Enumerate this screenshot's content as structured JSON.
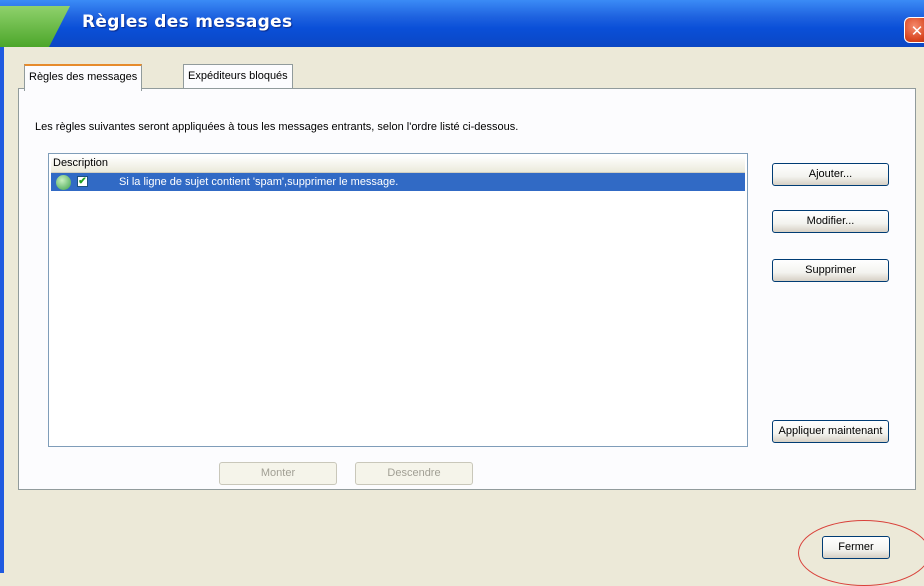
{
  "window": {
    "title": "Règles des messages",
    "close_glyph": "✕"
  },
  "tabs": [
    {
      "label": "Règles des messages",
      "active": true
    },
    {
      "label": "Expéditeurs bloqués",
      "active": false
    }
  ],
  "intro_text": "Les règles suivantes seront appliquées à tous les messages entrants, selon l'ordre listé ci-dessous.",
  "list": {
    "header": "Description",
    "rows": [
      {
        "checked": true,
        "check_glyph": "✔",
        "icon": "rule-icon",
        "text": "Si la ligne de sujet contient 'spam',supprimer le message.",
        "selected": true
      }
    ]
  },
  "buttons": {
    "add": "Ajouter...",
    "modify": "Modifier...",
    "delete": "Supprimer",
    "apply_now": "Appliquer maintenant",
    "move_up": "Monter",
    "move_down": "Descendre",
    "close": "Fermer"
  },
  "colors": {
    "titlebar": "#0a4fd8",
    "selection": "#316ac5",
    "annotation_circle": "#d9413a"
  }
}
